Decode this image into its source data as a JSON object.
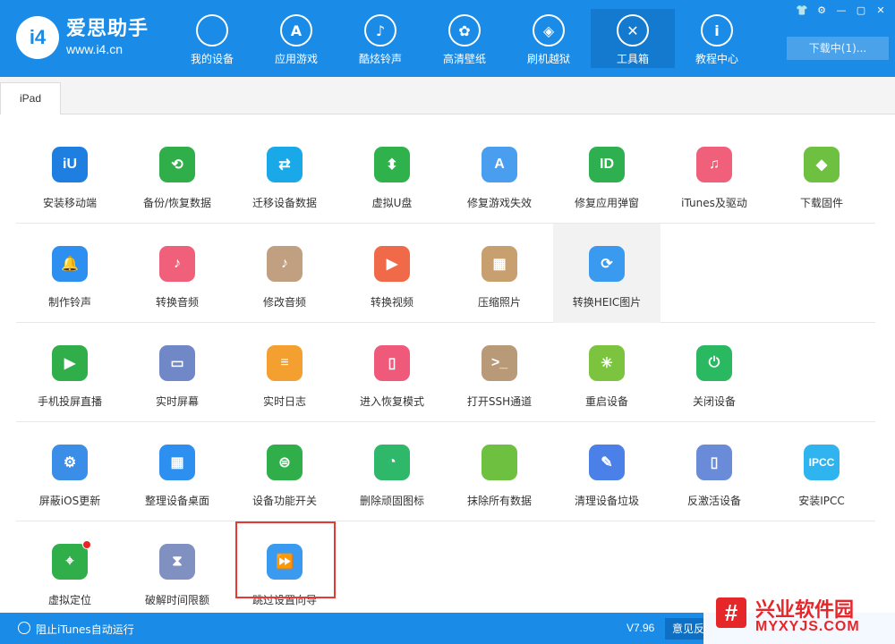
{
  "app": {
    "logo_badge": "i4",
    "name": "爱思助手",
    "url": "www.i4.cn"
  },
  "nav": [
    {
      "label": "我的设备",
      "icon": "apple-icon",
      "glyph": ""
    },
    {
      "label": "应用游戏",
      "icon": "appstore-icon",
      "glyph": "A"
    },
    {
      "label": "酷炫铃声",
      "icon": "bell-icon",
      "glyph": "♪"
    },
    {
      "label": "高清壁纸",
      "icon": "flower-icon",
      "glyph": "✿"
    },
    {
      "label": "刷机越狱",
      "icon": "dropbox-icon",
      "glyph": "◈"
    },
    {
      "label": "工具箱",
      "icon": "tools-icon",
      "glyph": "✕"
    },
    {
      "label": "教程中心",
      "icon": "info-icon",
      "glyph": "i"
    }
  ],
  "window_controls": [
    "👕",
    "⚙",
    "—",
    "▢",
    "✕"
  ],
  "download_label": "下载中(1)...",
  "tab_label": "iPad",
  "tools": [
    [
      {
        "label": "安装移动端",
        "color": "#1e7fe0",
        "glyph": "iU",
        "icon": "i4-install-icon"
      },
      {
        "label": "备份/恢复数据",
        "color": "#2fae4a",
        "glyph": "⟲",
        "icon": "backup-restore-icon"
      },
      {
        "label": "迁移设备数据",
        "color": "#1aa9e8",
        "glyph": "⇄",
        "icon": "migrate-data-icon"
      },
      {
        "label": "虚拟U盘",
        "color": "#2fb24c",
        "glyph": "⬍",
        "icon": "usb-drive-icon"
      },
      {
        "label": "修复游戏失效",
        "color": "#4a9ef0",
        "glyph": "A",
        "icon": "repair-game-icon"
      },
      {
        "label": "修复应用弹窗",
        "color": "#2eb050",
        "glyph": "ID",
        "icon": "apple-id-icon"
      },
      {
        "label": "iTunes及驱动",
        "color": "#f0607a",
        "glyph": "♫",
        "icon": "itunes-icon"
      },
      {
        "label": "下载固件",
        "color": "#6ec040",
        "glyph": "◆",
        "icon": "firmware-box-icon"
      }
    ],
    [
      {
        "label": "制作铃声",
        "color": "#2d8ff0",
        "glyph": "🔔",
        "icon": "make-ringtone-icon"
      },
      {
        "label": "转换音频",
        "color": "#f0607a",
        "glyph": "♪",
        "icon": "convert-audio-icon"
      },
      {
        "label": "修改音频",
        "color": "#c0a080",
        "glyph": "♪",
        "icon": "edit-audio-icon"
      },
      {
        "label": "转换视频",
        "color": "#f06a4a",
        "glyph": "▶",
        "icon": "convert-video-icon"
      },
      {
        "label": "压缩照片",
        "color": "#c8a070",
        "glyph": "▦",
        "icon": "compress-photo-icon"
      },
      {
        "label": "转换HEIC图片",
        "color": "#3a9af0",
        "glyph": "⟳",
        "icon": "heic-convert-icon",
        "highlight": true
      }
    ],
    [
      {
        "label": "手机投屏直播",
        "color": "#2fae4a",
        "glyph": "▶",
        "icon": "screen-mirror-icon"
      },
      {
        "label": "实时屏幕",
        "color": "#7088c8",
        "glyph": "▭",
        "icon": "realtime-screen-icon"
      },
      {
        "label": "实时日志",
        "color": "#f4a030",
        "glyph": "≡",
        "icon": "realtime-log-icon"
      },
      {
        "label": "进入恢复模式",
        "color": "#f05a7a",
        "glyph": "▯",
        "icon": "recovery-mode-icon"
      },
      {
        "label": "打开SSH通道",
        "color": "#b89a78",
        "glyph": ">_",
        "icon": "ssh-terminal-icon"
      },
      {
        "label": "重启设备",
        "color": "#7cc440",
        "glyph": "✳",
        "icon": "reboot-icon"
      },
      {
        "label": "关闭设备",
        "color": "#2ab860",
        "glyph": "⏻",
        "icon": "power-off-icon"
      }
    ],
    [
      {
        "label": "屏蔽iOS更新",
        "color": "#3a8ee8",
        "glyph": "⚙",
        "icon": "block-update-icon"
      },
      {
        "label": "整理设备桌面",
        "color": "#2d8ff0",
        "glyph": "▦",
        "icon": "organize-desktop-icon"
      },
      {
        "label": "设备功能开关",
        "color": "#2fae4a",
        "glyph": "⊜",
        "icon": "feature-toggle-icon"
      },
      {
        "label": "删除顽固图标",
        "color": "#2fb86a",
        "glyph": "◔",
        "icon": "delete-icon-icon"
      },
      {
        "label": "抹除所有数据",
        "color": "#6ec040",
        "glyph": "",
        "icon": "erase-data-icon"
      },
      {
        "label": "清理设备垃圾",
        "color": "#4a80e8",
        "glyph": "✎",
        "icon": "clean-junk-icon"
      },
      {
        "label": "反激活设备",
        "color": "#6a8cd8",
        "glyph": "▯",
        "icon": "deactivate-icon"
      },
      {
        "label": "安装IPCC",
        "color": "#30b4f0",
        "glyph": "IPCC",
        "icon": "ipcc-icon"
      }
    ],
    [
      {
        "label": "虚拟定位",
        "color": "#2fae4a",
        "glyph": "⌖",
        "icon": "location-pin-icon",
        "badge": true
      },
      {
        "label": "破解时间限额",
        "color": "#8090c0",
        "glyph": "⧗",
        "icon": "hourglass-icon"
      },
      {
        "label": "跳过设置向导",
        "color": "#3a9af0",
        "glyph": "⏩",
        "icon": "skip-setup-icon"
      }
    ]
  ],
  "footer": {
    "itunes_toggle_label": "阻止iTunes自动运行",
    "version": "V7.96",
    "feedback_label": "意见反"
  },
  "watermark": {
    "logo_glyph": "#",
    "name": "兴业软件园",
    "url": "MYXYJS.COM"
  }
}
